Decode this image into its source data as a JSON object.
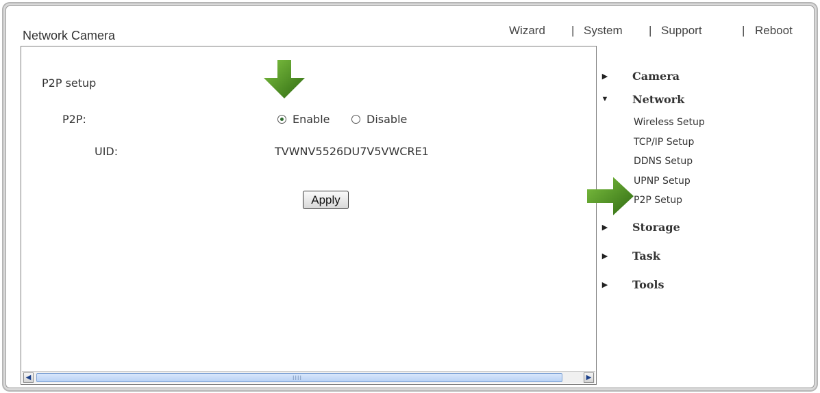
{
  "app": {
    "title": "Network Camera"
  },
  "top_menu": {
    "items": [
      "Wizard",
      "System",
      "Support",
      "Reboot"
    ],
    "separator": "|"
  },
  "p2p_setup": {
    "section_title": "P2P setup",
    "p2p_label": "P2P:",
    "options": [
      "Enable",
      "Disable"
    ],
    "selected": "Enable",
    "uid_label": "UID:",
    "uid_value": "TVWNV5526DU7V5VWCRE1",
    "apply_label": "Apply"
  },
  "scrollbar": {
    "left_arrow": "◀",
    "right_arrow": "▶",
    "grip": "IIII"
  },
  "sidebar": {
    "groups": [
      {
        "label": "Camera",
        "expanded": false
      },
      {
        "label": "Network",
        "expanded": true
      },
      {
        "label": "Storage",
        "expanded": false
      },
      {
        "label": "Task",
        "expanded": false
      },
      {
        "label": "Tools",
        "expanded": false
      }
    ],
    "network_items": [
      "Wireless Setup",
      "TCP/IP Setup",
      "DDNS Setup",
      "UPNP Setup",
      "P2P Setup"
    ],
    "active_item": "P2P Setup",
    "collapsed_glyph": "▶",
    "expanded_glyph": "▼"
  },
  "colors": {
    "arrow_green": "#4f9a21",
    "arrow_green_dark": "#2f6a12",
    "scroll_thumb": "#b9d2f5"
  }
}
